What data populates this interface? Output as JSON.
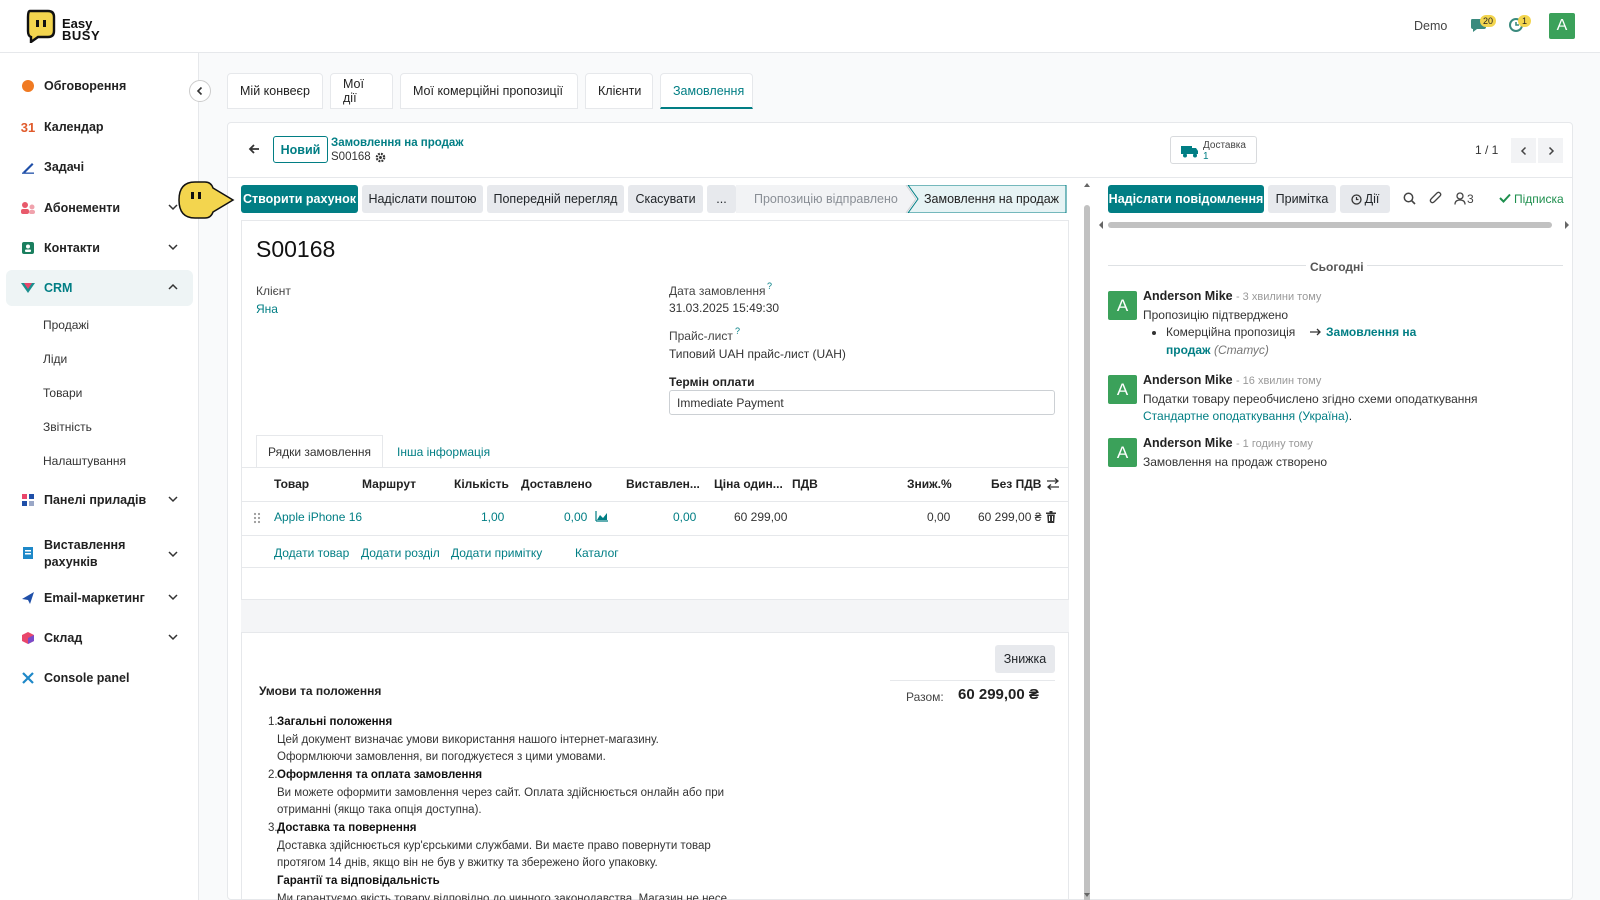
{
  "app": {
    "logo_line1": "Easy",
    "logo_line2": "BUSY"
  },
  "topbar": {
    "company": "Demo",
    "messages_badge": "20",
    "activities_badge": "1",
    "avatar_letter": "A"
  },
  "sidebar": {
    "items": [
      {
        "label": "Обговорення"
      },
      {
        "label": "Календар",
        "icon_text": "31"
      },
      {
        "label": "Задачі"
      },
      {
        "label": "Абонементи"
      },
      {
        "label": "Контакти"
      },
      {
        "label": "CRM"
      },
      {
        "label": "Панелі приладів"
      },
      {
        "label": "Виставлення",
        "label2": "рахунків"
      },
      {
        "label": "Email-маркетинг"
      },
      {
        "label": "Склад"
      },
      {
        "label": "Console panel"
      }
    ],
    "crm_sub": [
      {
        "label": "Продажі"
      },
      {
        "label": "Ліди"
      },
      {
        "label": "Товари"
      },
      {
        "label": "Звітність"
      },
      {
        "label": "Налаштування"
      }
    ]
  },
  "tabs": [
    {
      "label": "Мій конвеєр"
    },
    {
      "label": "Мої дії"
    },
    {
      "label": "Мої комерційні пропозиції"
    },
    {
      "label": "Клієнти"
    },
    {
      "label": "Замовлення"
    }
  ],
  "header": {
    "new_label": "Новий",
    "breadcrumb_parent": "Замовлення на продаж",
    "record_ref": "S00168",
    "delivery_label": "Доставка",
    "delivery_count": "1",
    "pager": "1 / 1"
  },
  "actions": {
    "create_invoice": "Створити рахунок",
    "send_email": "Надіслати поштою",
    "preview": "Попередній перегляд",
    "cancel": "Скасувати",
    "more": "..."
  },
  "status": {
    "stage1": "Пропозицію відправлено",
    "stage2": "Замовлення на продаж"
  },
  "form": {
    "title": "S00168",
    "client_label": "Клієнт",
    "client_value": "Яна",
    "order_date_label": "Дата замовлення",
    "order_date_value": "31.03.2025 15:49:30",
    "pricelist_label": "Прайс-лист",
    "pricelist_value": "Типовий UAH прайс-лист (UAH)",
    "payment_terms_label": "Термін оплати",
    "payment_terms_value": "Immediate Payment",
    "help_mark": "?"
  },
  "form_tabs": {
    "lines": "Рядки замовлення",
    "other": "Інша інформація"
  },
  "table": {
    "headers": {
      "product": "Товар",
      "route": "Маршрут",
      "qty": "Кількість",
      "delivered": "Доставлено",
      "invoiced": "Виставлен...",
      "unit_price": "Ціна один...",
      "vat": "ПДВ",
      "discount": "Зниж.%",
      "subtotal": "Без ПДВ"
    },
    "row": {
      "product": "Apple iPhone 16",
      "qty": "1,00",
      "delivered": "0,00",
      "invoiced": "0,00",
      "unit_price": "60 299,00",
      "discount": "0,00",
      "subtotal": "60 299,00 ₴"
    },
    "add_product": "Додати товар",
    "add_section": "Додати розділ",
    "add_note": "Додати примітку",
    "catalog": "Каталог"
  },
  "discount_button": "Знижка",
  "totals": {
    "label": "Разом:",
    "value": "60 299,00 ₴"
  },
  "terms": {
    "title": "Умови та положення",
    "items": [
      {
        "num": "1.",
        "heading": "Загальні положення",
        "line1": "Цей документ визначає умови використання нашого інтернет-магазину.",
        "line2": "Оформлюючи замовлення, ви погоджуєтеся з цими умовами."
      },
      {
        "num": "2.",
        "heading": "Оформлення та оплата замовлення",
        "line1": "Ви можете оформити замовлення через сайт. Оплата здійснюється онлайн або при",
        "line2": "отриманні (якщо така опція доступна)."
      },
      {
        "num": "3.",
        "heading": "Доставка та повернення",
        "line1": "Доставка здійснюється кур'єрськими службами. Ви маєте право повернути товар",
        "line2": "протягом 14 днів, якщо він не був у вжитку та збережено його упаковку."
      },
      {
        "num": "4.",
        "heading": "Гарантії та відповідальність",
        "line1": "Ми гарантуємо якість товару відповідно до чинного законодавства. Магазин не несе"
      }
    ]
  },
  "chatter": {
    "send_message": "Надіслати повідомлення",
    "log_note": "Примітка",
    "activities": "Дії",
    "followers_count": "3",
    "subscribe": "Підписка",
    "today": "Сьогодні",
    "messages": [
      {
        "avatar": "A",
        "author": "Anderson Mike",
        "time": "- 3 хвилини тому",
        "text": "Пропозицію підтверджено",
        "change_from": "Комерційна пропозиція",
        "change_to_1": "Замовлення на",
        "change_to_2": "продаж",
        "change_field": "(Статус)"
      },
      {
        "avatar": "A",
        "author": "Anderson Mike",
        "time": "- 16 хвилин тому",
        "text": "Податки товару переобчислено згідно схеми оподаткування",
        "link": "Стандартне оподаткування (Україна)",
        "link_tail": "."
      },
      {
        "avatar": "A",
        "author": "Anderson Mike",
        "time": "- 1 годину тому",
        "text": "Замовлення на продаж створено"
      }
    ]
  },
  "colors": {
    "accent": "#017e84",
    "avatar": "#3ba15a",
    "badge": "#f3d54e",
    "buttons_gray": "#e7e9ed"
  }
}
